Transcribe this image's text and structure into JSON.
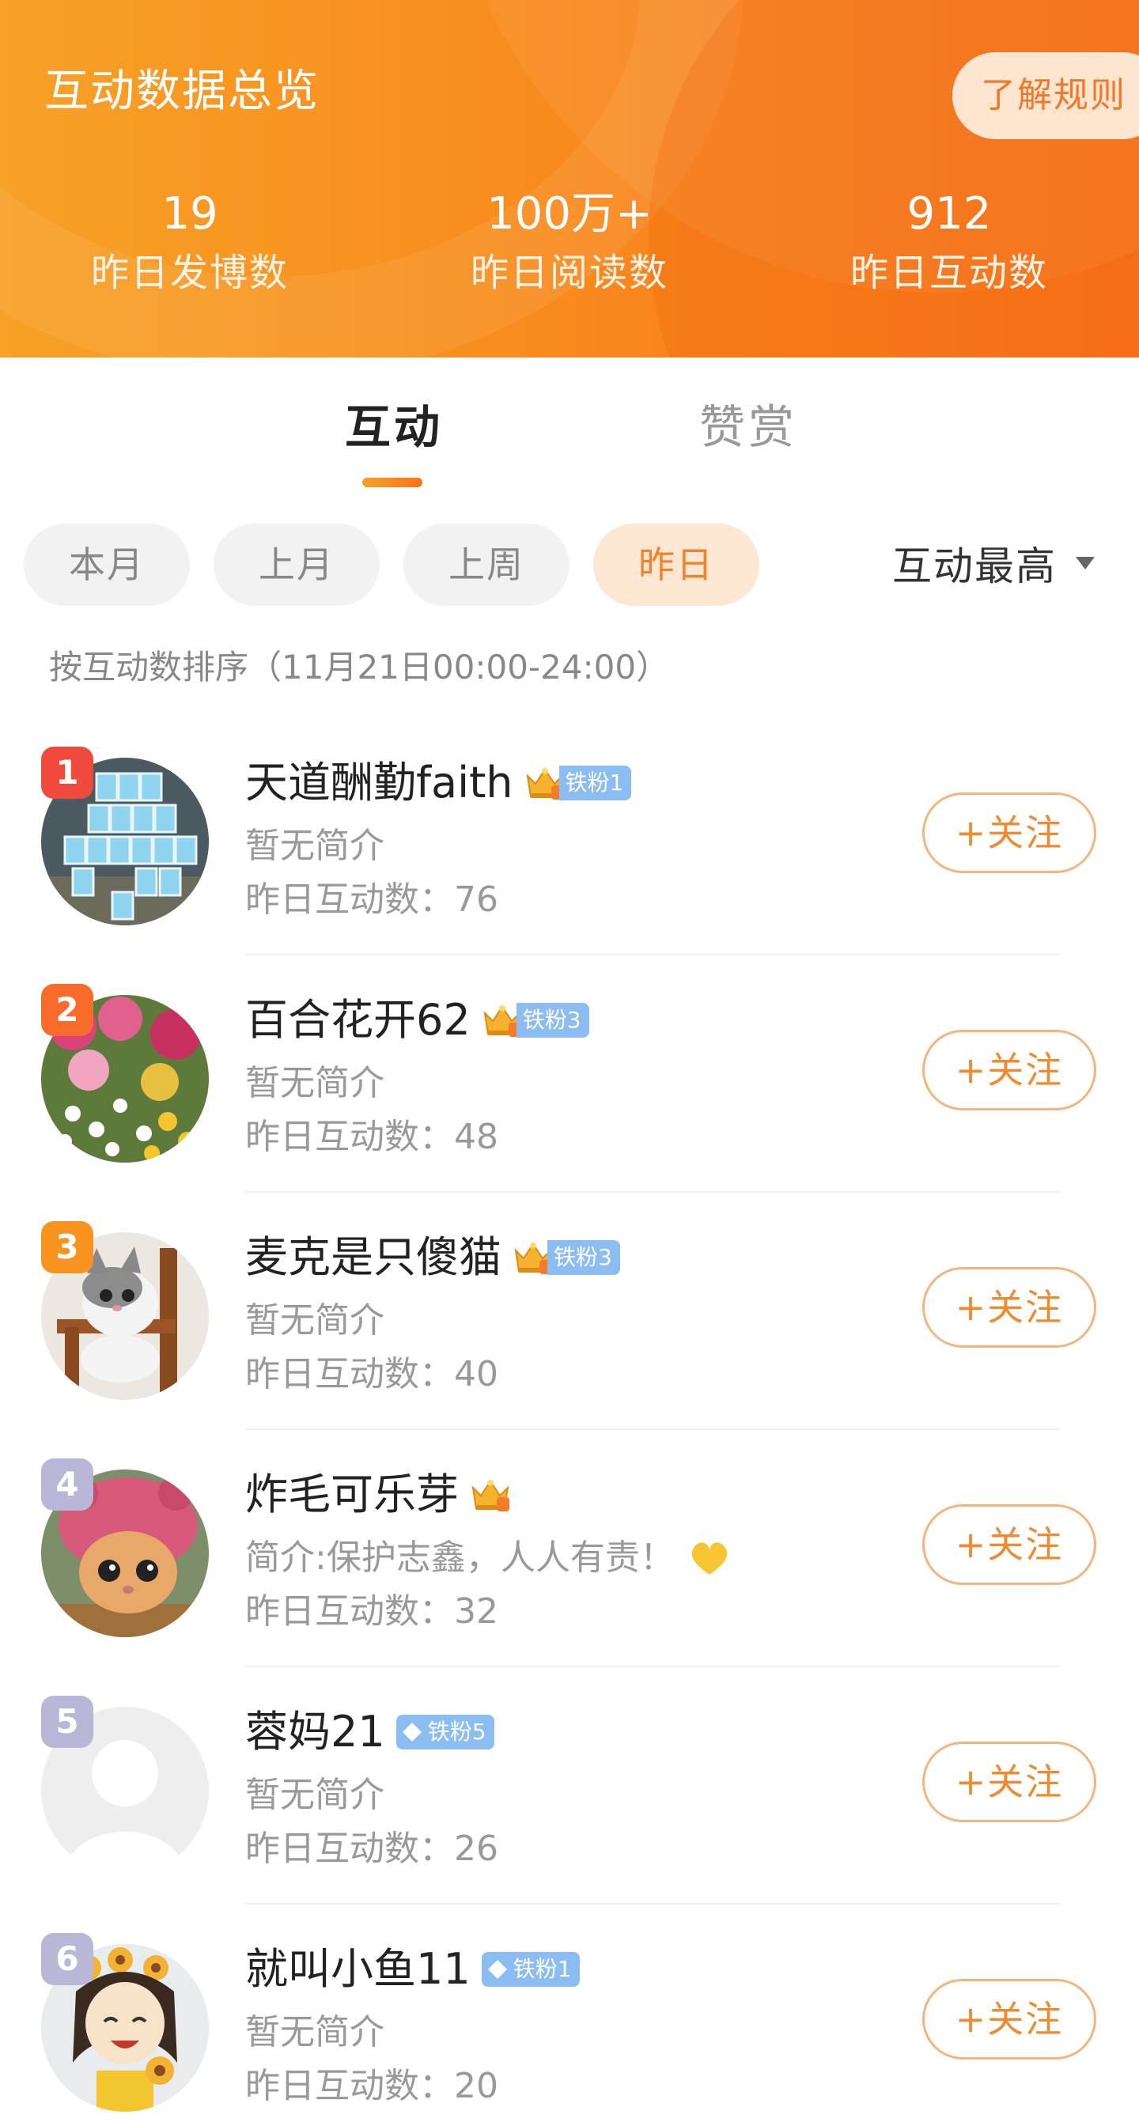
{
  "header": {
    "title": "互动数据总览",
    "rules_button": "了解规则",
    "stats": [
      {
        "value": "19",
        "label": "昨日发博数"
      },
      {
        "value": "100万+",
        "label": "昨日阅读数"
      },
      {
        "value": "912",
        "label": "昨日互动数"
      }
    ]
  },
  "tabs": [
    {
      "label": "互动",
      "active": true
    },
    {
      "label": "赞赏",
      "active": false
    }
  ],
  "filters": {
    "chips": [
      {
        "label": "本月",
        "active": false
      },
      {
        "label": "上月",
        "active": false
      },
      {
        "label": "上周",
        "active": false
      },
      {
        "label": "昨日",
        "active": true
      }
    ],
    "sort_label": "互动最高",
    "sort_note": "按互动数排序（11月21日00:00-24:00）"
  },
  "follow_label": "+关注",
  "users": [
    {
      "rank": "1",
      "name": "天道酬勤faith",
      "badge": "铁粉1",
      "badge_style": "crown",
      "bio": "暂无简介",
      "count": "昨日互动数：76",
      "rank_color": "#f04a3c"
    },
    {
      "rank": "2",
      "name": "百合花开62",
      "badge": "铁粉3",
      "badge_style": "crown",
      "bio": "暂无简介",
      "count": "昨日互动数：48",
      "rank_color": "#f76b2b"
    },
    {
      "rank": "3",
      "name": "麦克是只傻猫",
      "badge": "铁粉3",
      "badge_style": "crown",
      "bio": "暂无简介",
      "count": "昨日互动数：40",
      "rank_color": "#f7931e"
    },
    {
      "rank": "4",
      "name": "炸毛可乐芽",
      "badge": "",
      "badge_style": "crown-only",
      "bio": "简介:保护志鑫，人人有责！",
      "count": "昨日互动数：32",
      "rank_color": "#b9b7d8"
    },
    {
      "rank": "5",
      "name": "蓉妈21",
      "badge": "铁粉5",
      "badge_style": "diamond",
      "bio": "暂无简介",
      "count": "昨日互动数：26",
      "rank_color": "#b9b7d8"
    },
    {
      "rank": "6",
      "name": "就叫小鱼11",
      "badge": "铁粉1",
      "badge_style": "diamond",
      "bio": "暂无简介",
      "count": "昨日互动数：20",
      "rank_color": "#b9b7d8"
    }
  ]
}
